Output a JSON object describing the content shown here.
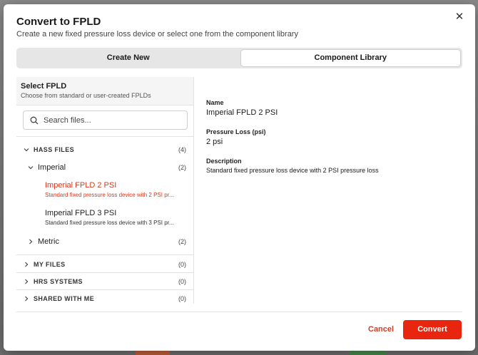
{
  "dialog": {
    "title": "Convert to FPLD",
    "subtitle": "Create a new fixed pressure loss device or select one from the component library"
  },
  "tabs": [
    {
      "label": "Create New",
      "active": false
    },
    {
      "label": "Component Library",
      "active": true
    }
  ],
  "browser": {
    "heading": "Select FPLD",
    "subheading": "Choose from standard or user-created FPLDs",
    "search_placeholder": "Search files...",
    "groups": {
      "hass": {
        "label": "HASS FILES",
        "count": "(4)"
      },
      "imperial": {
        "label": "Imperial",
        "count": "(2)"
      },
      "metric": {
        "label": "Metric",
        "count": "(2)"
      },
      "my_files": {
        "label": "MY FILES",
        "count": "(0)"
      },
      "hrs": {
        "label": "HRS SYSTEMS",
        "count": "(0)"
      },
      "shared": {
        "label": "SHARED WITH ME",
        "count": "(0)"
      }
    },
    "items": [
      {
        "name": "Imperial FPLD 2 PSI",
        "desc": "Standard fixed pressure loss device with 2 PSI pr...",
        "selected": true
      },
      {
        "name": "Imperial FPLD 3 PSI",
        "desc": "Standard fixed pressure loss device with 3 PSI pr...",
        "selected": false
      }
    ]
  },
  "details": {
    "name_label": "Name",
    "name_value": "Imperial FPLD 2 PSI",
    "pressure_label": "Pressure Loss (psi)",
    "pressure_value": "2 psi",
    "desc_label": "Description",
    "desc_value": "Standard fixed pressure loss device with 2 PSI pressure loss"
  },
  "footer": {
    "cancel_label": "Cancel",
    "convert_label": "Convert"
  },
  "colors": {
    "accent": "#e8260f",
    "selected_text": "#d63a1f"
  }
}
